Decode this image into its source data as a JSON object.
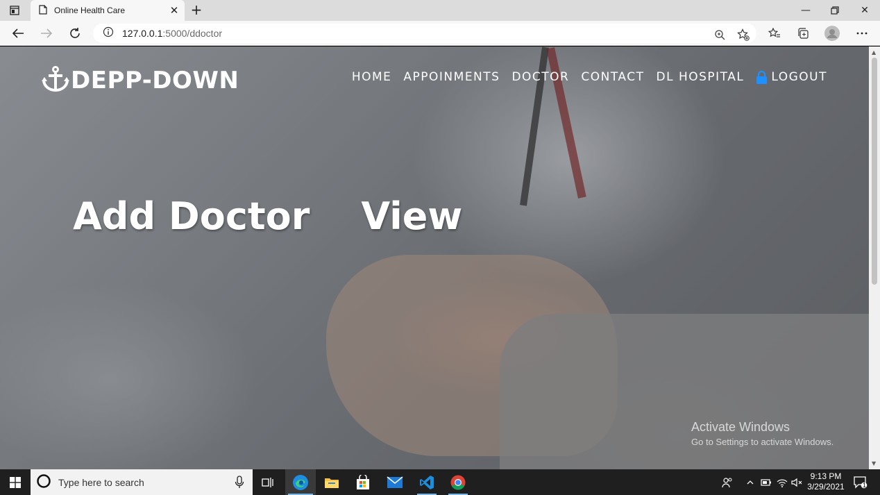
{
  "browser": {
    "tab_title": "Online Health Care",
    "url_host": "127.0.0.1",
    "url_path": ":5000/ddoctor"
  },
  "site": {
    "brand": "DEPP-DOWN",
    "nav": [
      {
        "label": "HOME"
      },
      {
        "label": "APPOINMENTS"
      },
      {
        "label": "DOCTOR"
      },
      {
        "label": "CONTACT"
      },
      {
        "label": "DL HOSPITAL"
      },
      {
        "label": "LOGOUT",
        "icon": "lock-icon"
      }
    ],
    "hero_links": [
      {
        "label": "Add Doctor"
      },
      {
        "label": "View"
      }
    ]
  },
  "watermark": {
    "title": "Activate Windows",
    "subtitle": "Go to Settings to activate Windows."
  },
  "taskbar": {
    "search_placeholder": "Type here to search",
    "time": "9:13 PM",
    "date": "3/29/2021",
    "notification_count": "1"
  },
  "colors": {
    "lock_icon": "#1e90ff",
    "taskbar_bg": "#1f1f1f",
    "accent": "#76b9ed"
  }
}
